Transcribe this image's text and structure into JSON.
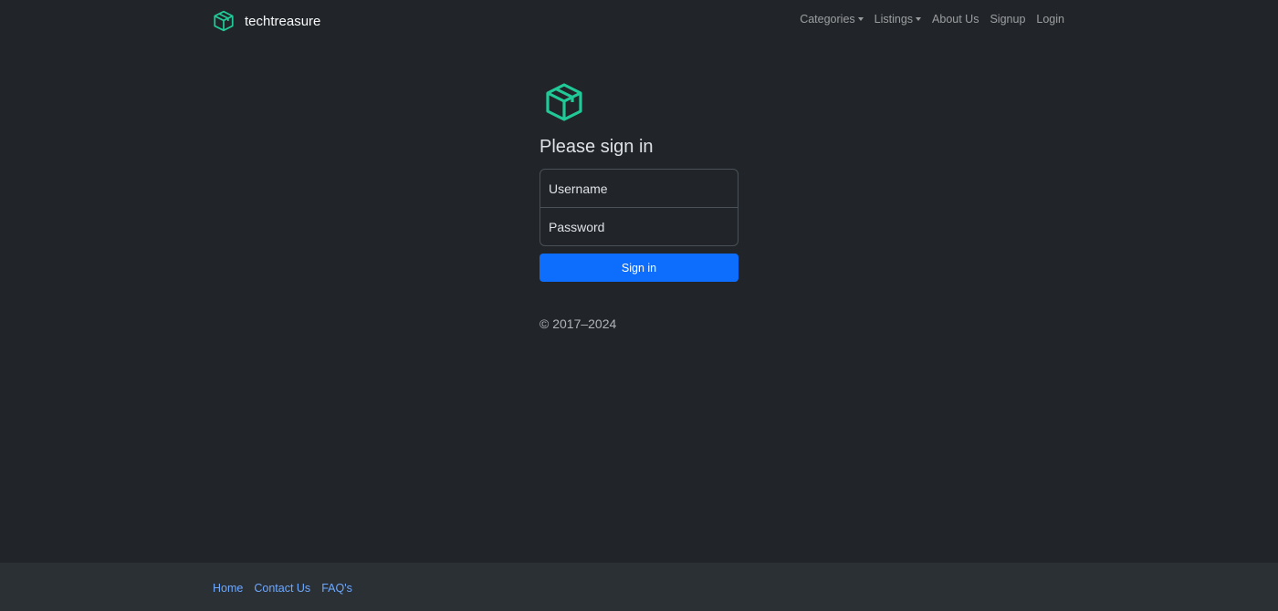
{
  "brand": {
    "name": "techtreasure",
    "icon": "box-seam-icon",
    "icon_color": "#20c997"
  },
  "nav": {
    "categories": "Categories",
    "listings": "Listings",
    "about": "About Us",
    "signup": "Signup",
    "login": "Login"
  },
  "signin": {
    "heading": "Please sign in",
    "username_placeholder": "Username",
    "password_placeholder": "Password",
    "button": "Sign in",
    "copyright": "© 2017–2024"
  },
  "footer": {
    "home": "Home",
    "contact": "Contact Us",
    "faq": "FAQ's"
  },
  "colors": {
    "background": "#212529",
    "footer_background": "#2b3035",
    "primary": "#0d6efd",
    "link": "#6ea8fe"
  }
}
